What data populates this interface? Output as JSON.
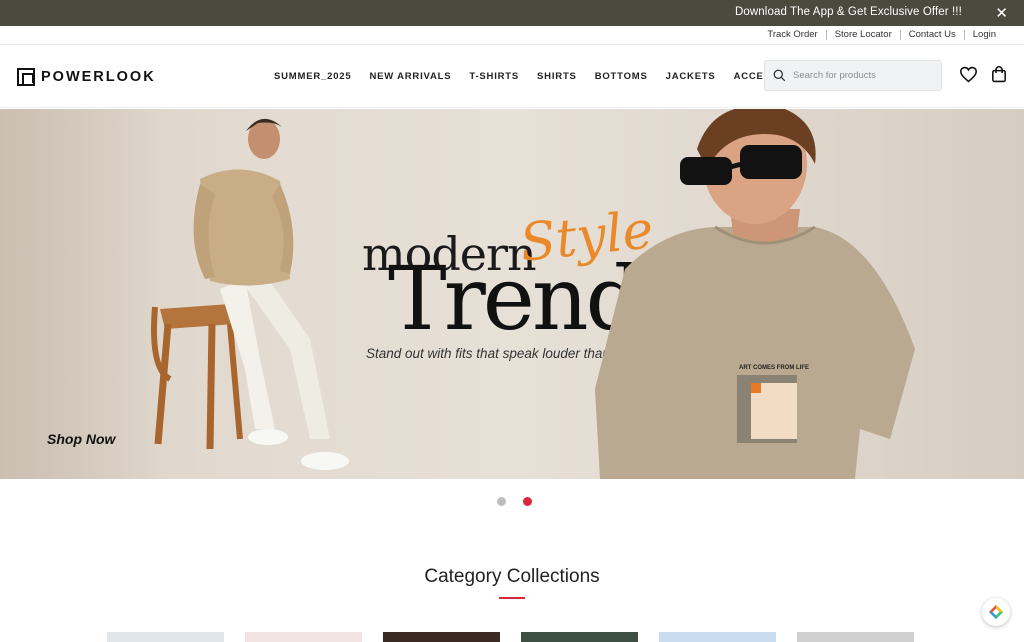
{
  "promo": {
    "text": "Download The App & Get Exclusive Offer !!!",
    "close_label": "✕"
  },
  "utility_links": [
    "Track Order",
    "Store Locator",
    "Contact Us",
    "Login"
  ],
  "brand": {
    "name": "POWERLOOK"
  },
  "nav": [
    "SUMMER_2025",
    "NEW ARRIVALS",
    "T-SHIRTS",
    "SHIRTS",
    "BOTTOMS",
    "JACKETS",
    "ACCESSORIES"
  ],
  "search": {
    "placeholder": "Search for products",
    "value": ""
  },
  "hero": {
    "line1": "modern",
    "script": "Style",
    "title": "Trends",
    "tagline": "Stand out with fits that speak louder than words",
    "cta": "Shop Now",
    "tee_print": "ART COMES FROM LIFE"
  },
  "carousel": {
    "slides": 2,
    "active_index": 1
  },
  "categories": {
    "title": "Category Collections"
  },
  "colors": {
    "promo_bg": "#4a4a3e",
    "accent": "#d8263a",
    "script": "#e9892a"
  },
  "icons": [
    "close-icon",
    "search-icon",
    "heart-icon",
    "bag-icon",
    "help-icon"
  ]
}
